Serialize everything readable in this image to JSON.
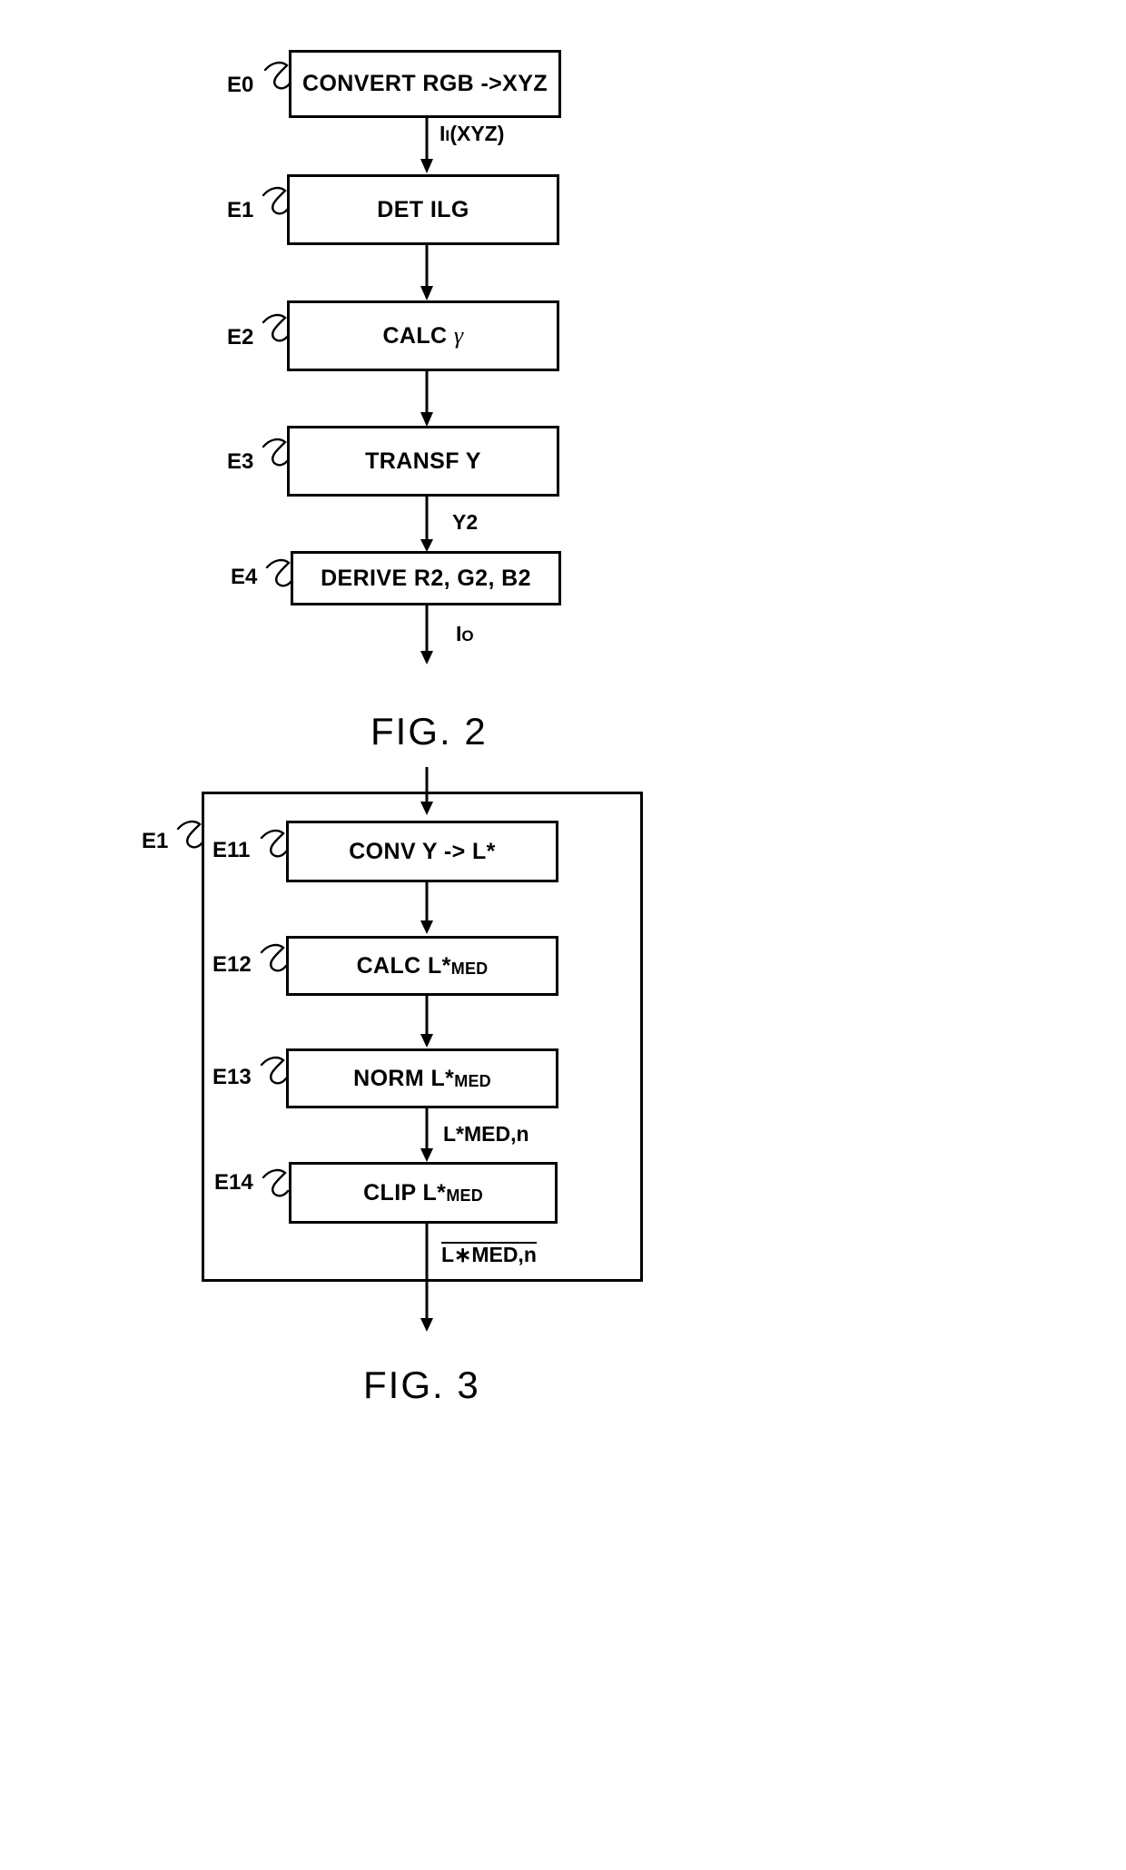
{
  "figure2": {
    "caption": "FIG. 2",
    "steps": [
      {
        "tag": "E0",
        "label": "CONVERT RGB ->XYZ"
      },
      {
        "tag": "E1",
        "label": "DET ILG"
      },
      {
        "tag": "E2",
        "label_main": "CALC",
        "label_sym": "γ"
      },
      {
        "tag": "E3",
        "label": "TRANSF Y"
      },
      {
        "tag": "E4",
        "label": "DERIVE R2, G2, B2"
      }
    ],
    "flow_labels": {
      "input_xyz_main": "I",
      "input_xyz_sub": "I",
      "input_xyz_tail": "(XYZ)",
      "y2": "Y2",
      "output_main": "I",
      "output_sub": "O"
    }
  },
  "figure3": {
    "caption": "FIG. 3",
    "group_tag": "E1",
    "steps": [
      {
        "tag": "E11",
        "label": "CONV Y -> L*"
      },
      {
        "tag": "E12",
        "label_main": "CALC L*",
        "label_sub": "MED"
      },
      {
        "tag": "E13",
        "label_main": "NORM L*",
        "label_sub": "MED"
      },
      {
        "tag": "E14",
        "label_main": "CLIP L*",
        "label_sub": "MED"
      }
    ],
    "flow_labels": {
      "norm_out_main": "L*MED",
      "norm_out_tail": ",n",
      "clip_out_main": "L∗MED,n"
    }
  }
}
